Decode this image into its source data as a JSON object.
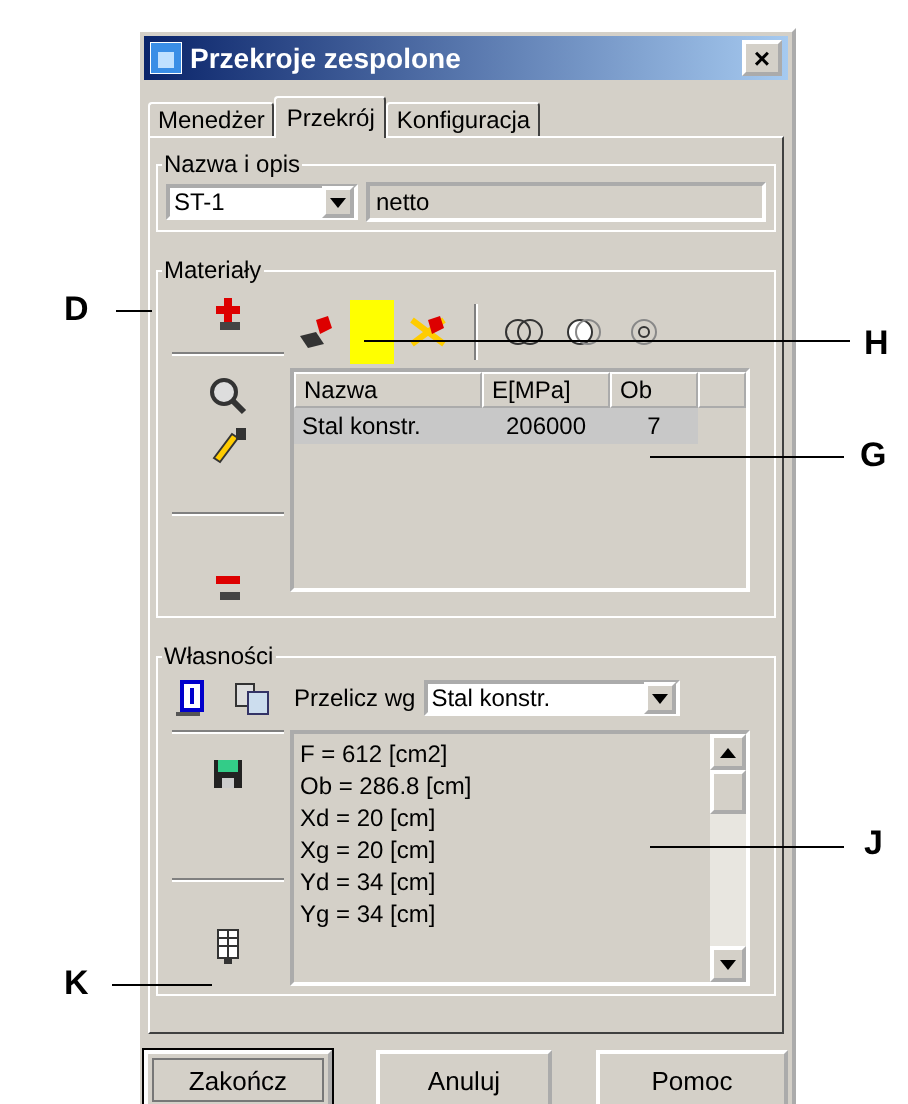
{
  "window": {
    "title": "Przekroje zespolone",
    "close": "×"
  },
  "tabs": [
    {
      "label": "Menedżer",
      "selected": false
    },
    {
      "label": "Przekrój",
      "selected": true
    },
    {
      "label": "Konfiguracja",
      "selected": false
    }
  ],
  "name_group": {
    "label": "Nazwa i opis",
    "section": "ST-1",
    "description": "netto"
  },
  "materials": {
    "label": "Materiały",
    "color": "#ffff00",
    "columns": [
      "Nazwa",
      "E[MPa]",
      "Ob"
    ],
    "rows": [
      {
        "cells": [
          "Stal konstr.",
          "206000",
          "7"
        ],
        "selected": true
      }
    ]
  },
  "properties": {
    "label": "Własności",
    "recalc_label": "Przelicz wg",
    "recalc_value": "Stal konstr.",
    "lines": [
      "F = 612 [cm2]",
      "Ob = 286.8 [cm]",
      "Xd = 20 [cm]",
      "Xg = 20 [cm]",
      "Yd = 34 [cm]",
      "Yg = 34 [cm]"
    ]
  },
  "buttons": [
    {
      "label": "Zakończ",
      "default": true
    },
    {
      "label": "Anuluj",
      "default": false
    },
    {
      "label": "Pomoc",
      "default": false
    }
  ],
  "annotations": [
    "D",
    "H",
    "G",
    "J",
    "K"
  ]
}
